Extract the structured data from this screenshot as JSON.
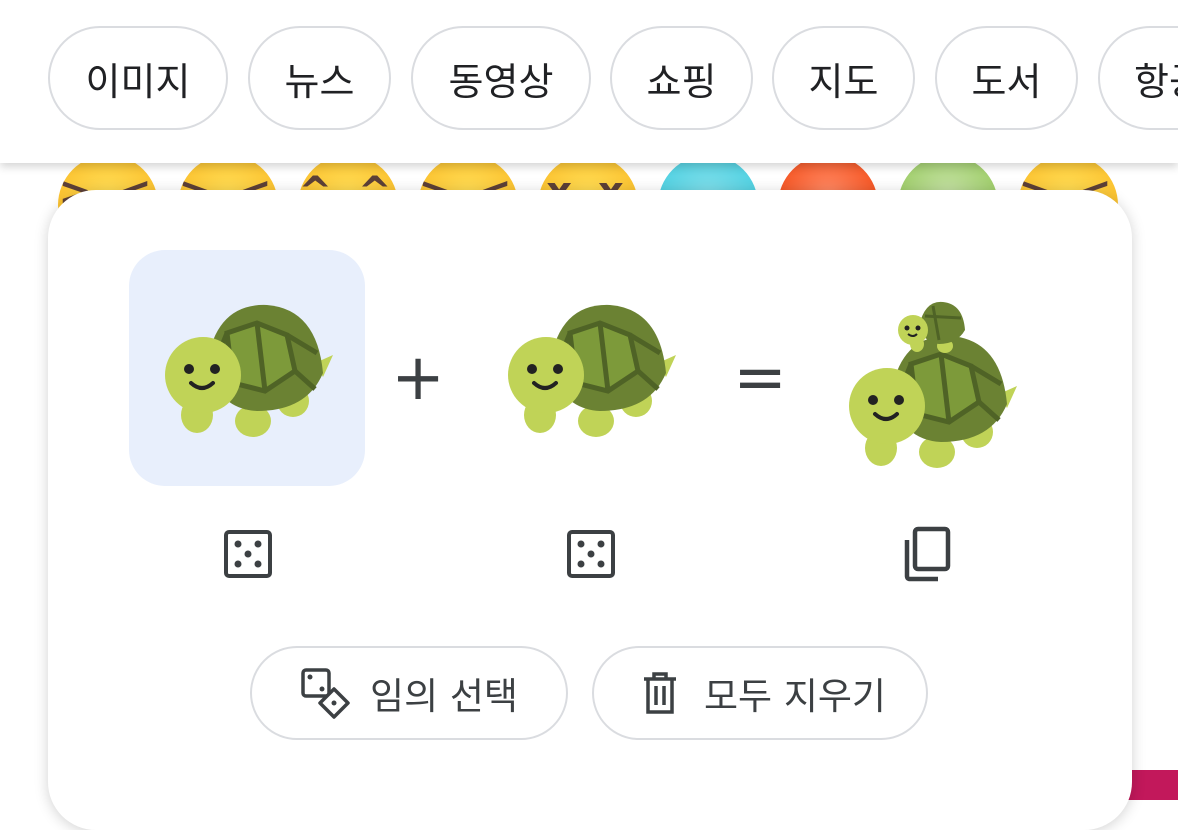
{
  "chips": [
    "이미지",
    "뉴스",
    "동영상",
    "쇼핑",
    "지도",
    "도서",
    "항공"
  ],
  "emoji_strip": {
    "faces": [
      "> <",
      "> <",
      "^ ^",
      "> <",
      "x x",
      "cold",
      "hot",
      "sick",
      "> <"
    ]
  },
  "kitchen": {
    "slot1": {
      "emoji": "turtle-emoji",
      "selected": true
    },
    "plus_label": "+",
    "slot2": {
      "emoji": "turtle-emoji",
      "selected": false
    },
    "equals_label": "=",
    "result": {
      "emoji": "turtle-on-turtle-emoji"
    },
    "random_label": "임의 선택",
    "clear_label": "모두 지우기"
  },
  "colors": {
    "slot_selected_bg": "#e8effc",
    "chip_border": "#dadce0",
    "turtle_body": "#c0d357",
    "turtle_shell": "#6b8233",
    "turtle_shell_dark": "#4f6326"
  }
}
